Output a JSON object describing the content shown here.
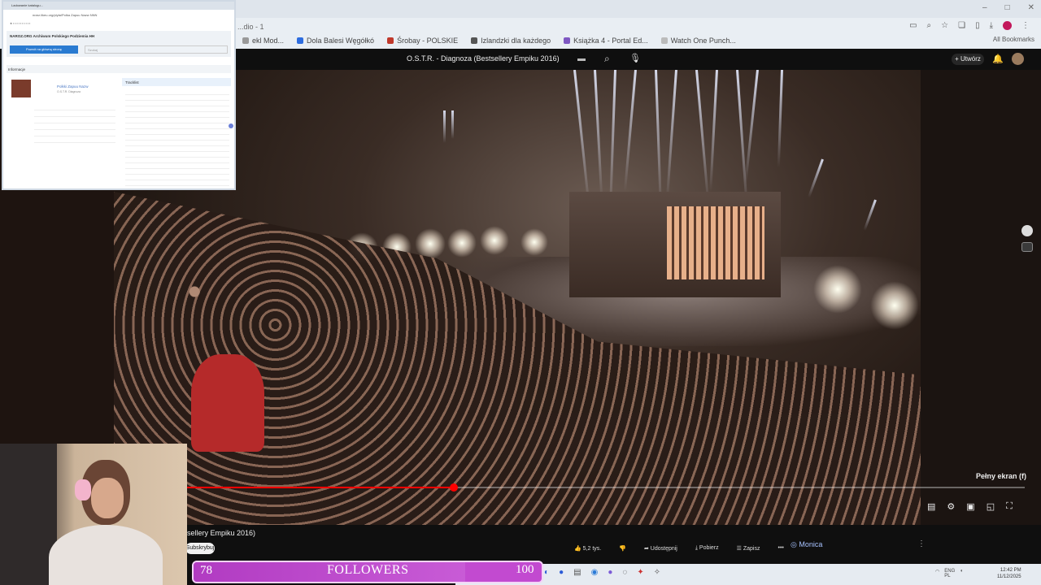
{
  "browser": {
    "tab_fragment": "...dio - 1",
    "bookmarks": [
      "ekl Mod...",
      "Dola Balesi Węgółkó",
      "Śrobay - POLSKIE",
      "Izlandzki dla każdego",
      "Książka 4 - Portal Ed...",
      "Watch One Punch..."
    ],
    "all_bookmarks": "All Bookmarks",
    "window_controls": [
      "–",
      "□",
      "✕"
    ]
  },
  "youtube": {
    "video_title": "O.S.T.R. - Diagnoza (Bestsellery Empiku 2016)",
    "video_title_below": "sellery Empiku 2016)",
    "create_label": "+ Utwórz",
    "subscribe_label": "Subskrybuj",
    "fullscreen_tooltip": "Pełny ekran (f)",
    "progress_fraction": 0.32,
    "actions": {
      "likes": "5,2 tys.",
      "share": "Udostępnij",
      "download": "Pobierz",
      "save": "Zapisz",
      "more": "•••"
    },
    "monica_label": "Monica"
  },
  "popup": {
    "tab_label": "Ladowanie katalogu...",
    "url": "nrarz.likeu.org/plyta/Polka Zapuu Nazw NNN",
    "heading": "NAROZ.ORG Archiwum Polskiego Podziemia HH",
    "blue_button": "Powrót na główną stronę",
    "search_placeholder": "Szukaj",
    "info_label": "Informacje",
    "album_title": "Polkki Zapuu Nazw",
    "album_subtitle": "O.S.T.R. Diagnoza",
    "tracklist_label": "Tracklist"
  },
  "followers": {
    "current": "78",
    "label": "FOLLOWERS",
    "goal": "100",
    "fill_fraction": 0.78
  },
  "taskbar": {
    "tray_lang": "ENG",
    "tray_region": "PL",
    "clock_time": "12:42 PM",
    "clock_date": "11/12/2025"
  }
}
